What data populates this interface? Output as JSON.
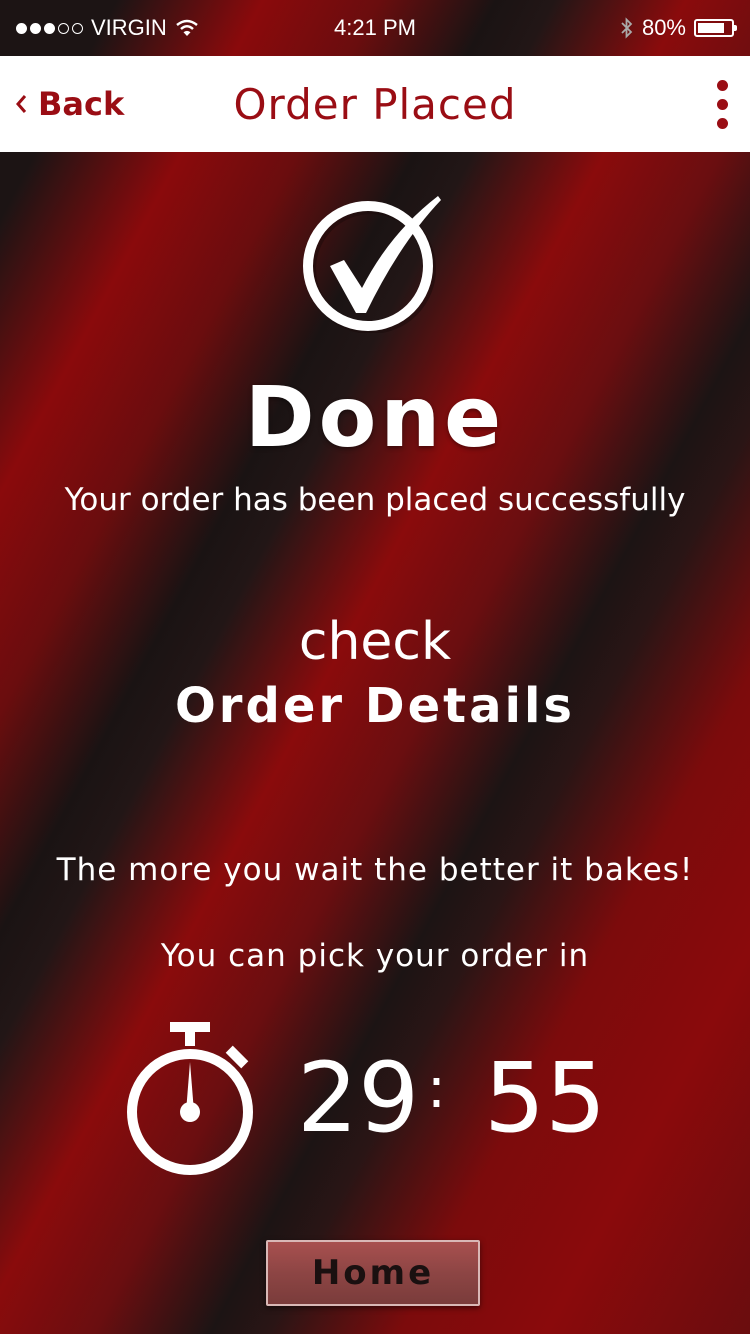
{
  "status_bar": {
    "carrier": "VIRGIN",
    "time": "4:21 PM",
    "battery": "80%",
    "battery_level": 0.8,
    "signal_bars": 3,
    "signal_total": 5
  },
  "nav": {
    "back_label": "Back",
    "title": "Order Placed",
    "menu_icon": "more-vertical-icon"
  },
  "main": {
    "done_heading": "Done",
    "subtitle": "Your order has been placed successfully",
    "check_word": "check",
    "order_details_link": "Order Details",
    "wait_text": "The more you wait the better it bakes!",
    "pick_text": "You can pick your order in",
    "timer": {
      "minutes": "29",
      "separator": ":",
      "seconds": "55"
    },
    "home_button": "Home"
  },
  "colors": {
    "accent": "#9a0d14",
    "background_dark": "#1c1414",
    "background_red": "#8a0a0c"
  }
}
